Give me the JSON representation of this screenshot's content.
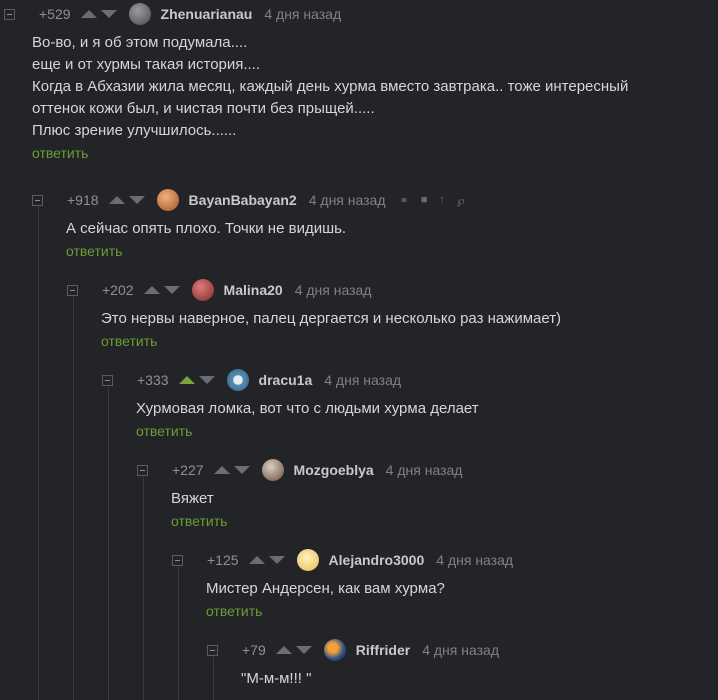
{
  "comments": [
    {
      "rating": "+529",
      "user": "Zhenuarianau",
      "time": "4 дня назад",
      "lines": [
        "Во-во, и я об этом подумала....",
        "еще и от хурмы такая история....",
        "Когда в Абхазии жила месяц, каждый день хурма вместо завтрака.. тоже интересный",
        "оттенок кожи был, и чистая почти без прыщей.....",
        "Плюс зрение улучшилось......"
      ],
      "reply": "ответить",
      "avatar_color": "#5a5c60"
    },
    {
      "rating": "+918",
      "user": "BayanBabayan2",
      "time": "4 дня назад",
      "lines": [
        "А сейчас опять плохо. Точки не видишь."
      ],
      "reply": "ответить",
      "avatar_color": "#c97a3a"
    },
    {
      "rating": "+202",
      "user": "Malina20",
      "time": "4 дня назад",
      "lines": [
        "Это нервы наверное, палец дергается и несколько раз нажимает)"
      ],
      "reply": "ответить",
      "avatar_color": "#b24a4a"
    },
    {
      "rating": "+333",
      "user": "dracu1a",
      "time": "4 дня назад",
      "lines": [
        "Хурмовая ломка, вот что с людьми хурма делает"
      ],
      "reply": "ответить",
      "avatar_color": "#4a7fa6"
    },
    {
      "rating": "+227",
      "user": "Mozgoeblya",
      "time": "4 дня назад",
      "lines": [
        "Вяжет"
      ],
      "reply": "ответить",
      "avatar_color": "#7a6a5a"
    },
    {
      "rating": "+125",
      "user": "Alejandro3000",
      "time": "4 дня назад",
      "lines": [
        "Мистер Андерсен, как вам хурма?"
      ],
      "reply": "ответить",
      "avatar_color": "#e8c46a"
    },
    {
      "rating": "+79",
      "user": "Riffrider",
      "time": "4 дня назад",
      "lines": [
        "\"М-м-м!!! \""
      ],
      "reply": "",
      "avatar_color": "#3a6fb0"
    }
  ]
}
